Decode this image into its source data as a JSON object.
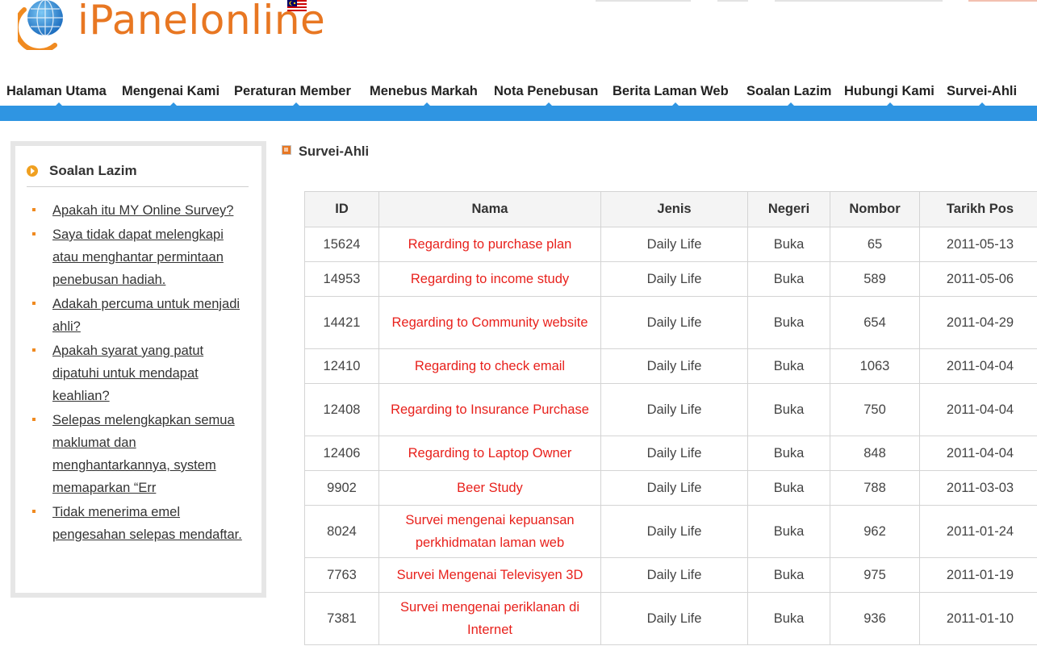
{
  "logo": {
    "text": "iPanelonline"
  },
  "nav": {
    "items": [
      "Halaman Utama",
      "Mengenai Kami",
      "Peraturan Member",
      "Menebus Markah",
      "Nota Penebusan",
      "Berita Laman Web",
      "Soalan Lazim",
      "Hubungi Kami",
      "Survei-Ahli"
    ]
  },
  "sidebar": {
    "title": "Soalan Lazim",
    "items": [
      "Apakah itu MY Online Survey?",
      "Saya tidak dapat melengkapi atau menghantar permintaan penebusan hadiah.",
      "Adakah percuma untuk menjadi ahli?",
      "Apakah syarat yang patut dipatuhi untuk mendapat keahlian?",
      "Selepas melengkapkan semua maklumat dan menghantarkannya, system memaparkan “Err",
      "Tidak menerima emel pengesahan selepas mendaftar."
    ]
  },
  "main": {
    "section_title": "Survei-Ahli",
    "table": {
      "headers": [
        "ID",
        "Nama",
        "Jenis",
        "Negeri",
        "Nombor",
        "Tarikh Pos"
      ],
      "rows": [
        [
          "15624",
          "Regarding to purchase plan",
          "Daily Life",
          "Buka",
          "65",
          "2011-05-13"
        ],
        [
          "14953",
          "Regarding to income study",
          "Daily Life",
          "Buka",
          "589",
          "2011-05-06"
        ],
        [
          "14421",
          "Regarding to Community website",
          "Daily Life",
          "Buka",
          "654",
          "2011-04-29"
        ],
        [
          "12410",
          "Regarding to check email",
          "Daily Life",
          "Buka",
          "1063",
          "2011-04-04"
        ],
        [
          "12408",
          "Regarding to Insurance Purchase",
          "Daily Life",
          "Buka",
          "750",
          "2011-04-04"
        ],
        [
          "12406",
          "Regarding to Laptop Owner",
          "Daily Life",
          "Buka",
          "848",
          "2011-04-04"
        ],
        [
          "9902",
          "Beer Study",
          "Daily Life",
          "Buka",
          "788",
          "2011-03-03"
        ],
        [
          "8024",
          "Survei mengenai kepuansan perkhidmatan laman web",
          "Daily Life",
          "Buka",
          "962",
          "2011-01-24"
        ],
        [
          "7763",
          "Survei Mengenai Televisyen 3D",
          "Daily Life",
          "Buka",
          "975",
          "2011-01-19"
        ],
        [
          "7381",
          "Survei mengenai periklanan di Internet",
          "Daily Life",
          "Buka",
          "936",
          "2011-01-10"
        ]
      ]
    }
  },
  "colors": {
    "brand_orange": "#e87722",
    "nav_blue": "#2f95e2",
    "link_red": "#e8211c"
  }
}
